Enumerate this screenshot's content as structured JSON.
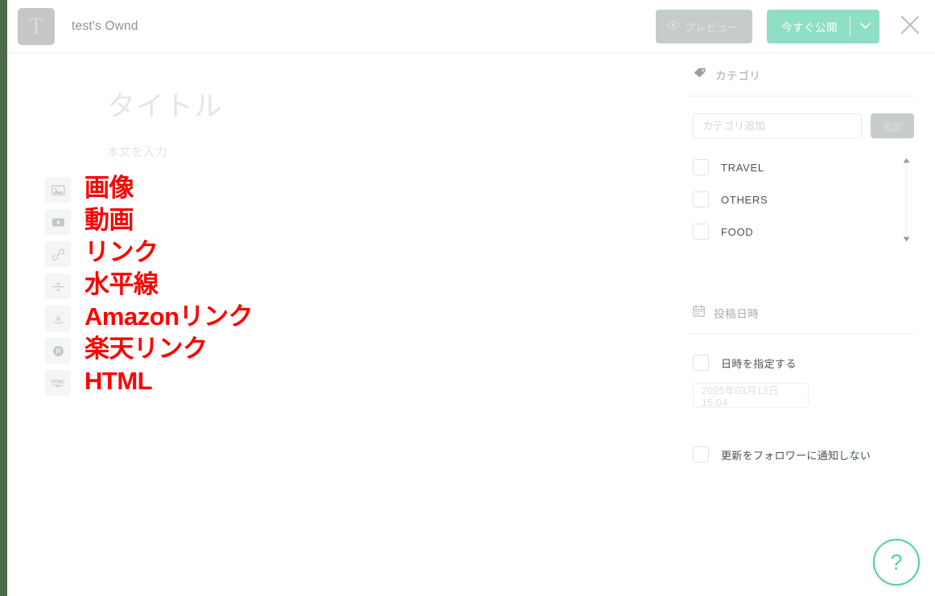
{
  "header": {
    "logo_letter": "T",
    "site_title": "test's Ownd",
    "preview_label": "プレビュー",
    "publish_label": "今すぐ公開",
    "preview_icon": "eye-icon",
    "caret_icon": "chevron-down-icon",
    "close_icon": "close-icon"
  },
  "editor": {
    "title_placeholder": "タイトル",
    "body_placeholder": "本文を入力"
  },
  "tools": [
    {
      "icon": "image-icon",
      "annotation": "画像"
    },
    {
      "icon": "video-icon",
      "annotation": "動画"
    },
    {
      "icon": "link-icon",
      "annotation": "リンク"
    },
    {
      "icon": "horizontal-rule-icon",
      "annotation": "水平線"
    },
    {
      "icon": "amazon-icon",
      "annotation": "Amazonリンク"
    },
    {
      "icon": "rakuten-icon",
      "annotation": "楽天リンク"
    },
    {
      "icon": "html-icon",
      "annotation": "HTML"
    }
  ],
  "sidebar": {
    "category": {
      "icon": "tag-icon",
      "heading": "カテゴリ",
      "input_placeholder": "カテゴリ追加",
      "input_value": "",
      "add_button_label": "追加",
      "items": [
        {
          "label": "TRAVEL",
          "checked": false
        },
        {
          "label": "OTHERS",
          "checked": false
        },
        {
          "label": "FOOD",
          "checked": false
        }
      ],
      "scroll_up_icon": "triangle-up-icon",
      "scroll_down_icon": "triangle-down-icon"
    },
    "schedule": {
      "icon": "calendar-icon",
      "heading": "投稿日時",
      "specify_label": "日時を指定する",
      "specify_checked": false,
      "datetime_value": "2025年03月13日 15:04",
      "no_notify_label": "更新をフォロワーに通知しない",
      "no_notify_checked": false
    }
  },
  "help": {
    "icon": "question-mark-icon",
    "label": "?"
  },
  "colors": {
    "rail_green": "#4a6b45",
    "publish_mint": "#8edfc6",
    "help_teal": "#4ed0ab",
    "annotation_red": "#ff0000",
    "disabled_gray": "#c6cbcb"
  }
}
